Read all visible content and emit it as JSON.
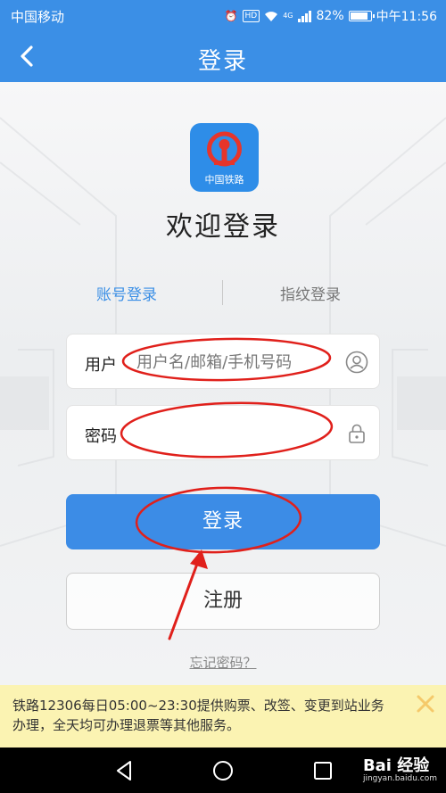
{
  "status_bar": {
    "carrier": "中国移动",
    "network": "4G",
    "battery": "82%",
    "time": "中午11:56"
  },
  "header": {
    "title": "登录",
    "back_icon": "chevron-left-icon"
  },
  "logo": {
    "text": "中国铁路",
    "color": "#2e8de8"
  },
  "welcome": "欢迎登录",
  "tabs": {
    "account": "账号登录",
    "fingerprint": "指纹登录",
    "active": "account"
  },
  "form": {
    "user_label": "用户",
    "user_placeholder": "用户名/邮箱/手机号码",
    "user_icon": "user-icon",
    "password_label": "密码",
    "password_placeholder": "",
    "password_icon": "lock-icon",
    "login_label": "登录",
    "register_label": "注册",
    "forgot_label": "忘记密码？"
  },
  "notice": {
    "text": "铁路12306每日05:00~23:30提供购票、改签、变更到站业务办理，全天均可办理退票等其他服务。",
    "close_icon": "close-icon"
  },
  "colors": {
    "accent": "#3b8fe6",
    "annotation": "#e0201b",
    "notice_bg": "#fbf3b2"
  },
  "watermark": {
    "brand": "Bai 经验",
    "site": "jingyan.baidu.com"
  }
}
